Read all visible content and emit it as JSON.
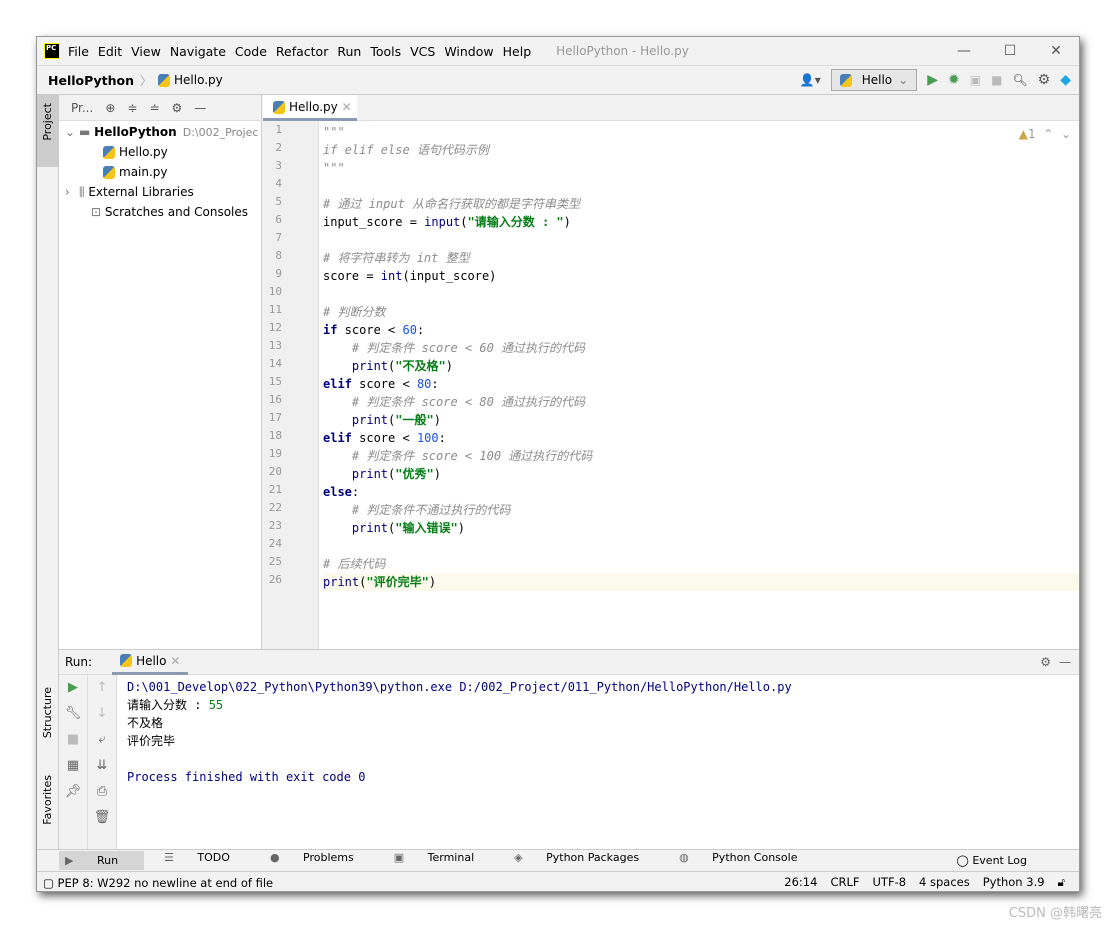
{
  "app": {
    "logo": "PC",
    "window_title": "HelloPython - Hello.py"
  },
  "menu": [
    "File",
    "Edit",
    "View",
    "Navigate",
    "Code",
    "Refactor",
    "Run",
    "Tools",
    "VCS",
    "Window",
    "Help"
  ],
  "breadcrumb": {
    "project": "HelloPython",
    "file": "Hello.py"
  },
  "run_config": "Hello",
  "sidebar_tabs": {
    "project": "Project",
    "structure": "Structure",
    "favorites": "Favorites"
  },
  "project_panel": {
    "dropdown": "Pr...",
    "tree": [
      {
        "label": "HelloPython",
        "extra": "D:\\002_Projec",
        "bold": true,
        "indent": 0,
        "arrow": "v"
      },
      {
        "label": "Hello.py",
        "indent": 2
      },
      {
        "label": "main.py",
        "indent": 2
      },
      {
        "label": "External Libraries",
        "indent": 0,
        "arrow": ">"
      },
      {
        "label": "Scratches and Consoles",
        "indent": 1
      }
    ]
  },
  "editor": {
    "tab": "Hello.py",
    "warnings": "1",
    "current_line": 26,
    "lines": [
      [
        [
          "cm",
          "\"\"\""
        ]
      ],
      [
        [
          "cm",
          "if elif else 语句代码示例"
        ]
      ],
      [
        [
          "cm",
          "\"\"\""
        ]
      ],
      [],
      [
        [
          "cm",
          "# 通过 input 从命名行获取的都是字符串类型"
        ]
      ],
      [
        [
          "",
          "input_score = "
        ],
        [
          "bi",
          "input"
        ],
        [
          "",
          "("
        ],
        [
          "st",
          "\"请输入分数 : \""
        ],
        [
          "",
          ")"
        ]
      ],
      [],
      [
        [
          "cm",
          "# 将字符串转为 int 整型"
        ]
      ],
      [
        [
          "",
          "score = "
        ],
        [
          "bi",
          "int"
        ],
        [
          "",
          "(input_score)"
        ]
      ],
      [],
      [
        [
          "cm",
          "# 判断分数"
        ]
      ],
      [
        [
          "kw",
          "if"
        ],
        [
          "",
          " score < "
        ],
        [
          "nu",
          "60"
        ],
        [
          "",
          ":"
        ]
      ],
      [
        [
          "",
          "    "
        ],
        [
          "cm",
          "# 判定条件 score < 60 通过执行的代码"
        ]
      ],
      [
        [
          "",
          "    "
        ],
        [
          "bi",
          "print"
        ],
        [
          "",
          "("
        ],
        [
          "st",
          "\"不及格\""
        ],
        [
          "",
          ")"
        ]
      ],
      [
        [
          "kw",
          "elif"
        ],
        [
          "",
          " score < "
        ],
        [
          "nu",
          "80"
        ],
        [
          "",
          ":"
        ]
      ],
      [
        [
          "",
          "    "
        ],
        [
          "cm",
          "# 判定条件 score < 80 通过执行的代码"
        ]
      ],
      [
        [
          "",
          "    "
        ],
        [
          "bi",
          "print"
        ],
        [
          "",
          "("
        ],
        [
          "st",
          "\"一般\""
        ],
        [
          "",
          ")"
        ]
      ],
      [
        [
          "kw",
          "elif"
        ],
        [
          "",
          " score < "
        ],
        [
          "nu",
          "100"
        ],
        [
          "",
          ":"
        ]
      ],
      [
        [
          "",
          "    "
        ],
        [
          "cm",
          "# 判定条件 score < 100 通过执行的代码"
        ]
      ],
      [
        [
          "",
          "    "
        ],
        [
          "bi",
          "print"
        ],
        [
          "",
          "("
        ],
        [
          "st",
          "\"优秀\""
        ],
        [
          "",
          ")"
        ]
      ],
      [
        [
          "kw",
          "else"
        ],
        [
          "",
          ":"
        ]
      ],
      [
        [
          "",
          "    "
        ],
        [
          "cm",
          "# 判定条件不通过执行的代码"
        ]
      ],
      [
        [
          "",
          "    "
        ],
        [
          "bi",
          "print"
        ],
        [
          "",
          "("
        ],
        [
          "st",
          "\"输入错误\""
        ],
        [
          "",
          ")"
        ]
      ],
      [],
      [
        [
          "cm",
          "# 后续代码"
        ]
      ],
      [
        [
          "bi",
          "print"
        ],
        [
          "",
          "("
        ],
        [
          "st",
          "\"评价完毕\""
        ],
        [
          "",
          ")"
        ]
      ]
    ]
  },
  "run_panel": {
    "label": "Run:",
    "tab": "Hello",
    "output": [
      {
        "text": "D:\\001_Develop\\022_Python\\Python39\\python.exe D:/002_Project/011_Python/HelloPython/Hello.py",
        "color": "#000080"
      },
      {
        "text": "请输入分数 : ",
        "input": "55"
      },
      {
        "text": "不及格"
      },
      {
        "text": "评价完毕"
      },
      {
        "text": ""
      },
      {
        "text": "Process finished with exit code 0",
        "color": "#000080"
      }
    ]
  },
  "bottom_tabs": [
    "Run",
    "TODO",
    "Problems",
    "Terminal",
    "Python Packages",
    "Python Console"
  ],
  "event_log": "Event Log",
  "status": {
    "message": "PEP 8: W292 no newline at end of file",
    "position": "26:14",
    "line_sep": "CRLF",
    "encoding": "UTF-8",
    "indent": "4 spaces",
    "interpreter": "Python 3.9"
  },
  "watermark": "CSDN @韩曙亮",
  "colors": {
    "keyword": "#000080",
    "string": "#067d17",
    "number": "#1750eb",
    "comment": "#8c8c8c",
    "run": "#499c54"
  }
}
